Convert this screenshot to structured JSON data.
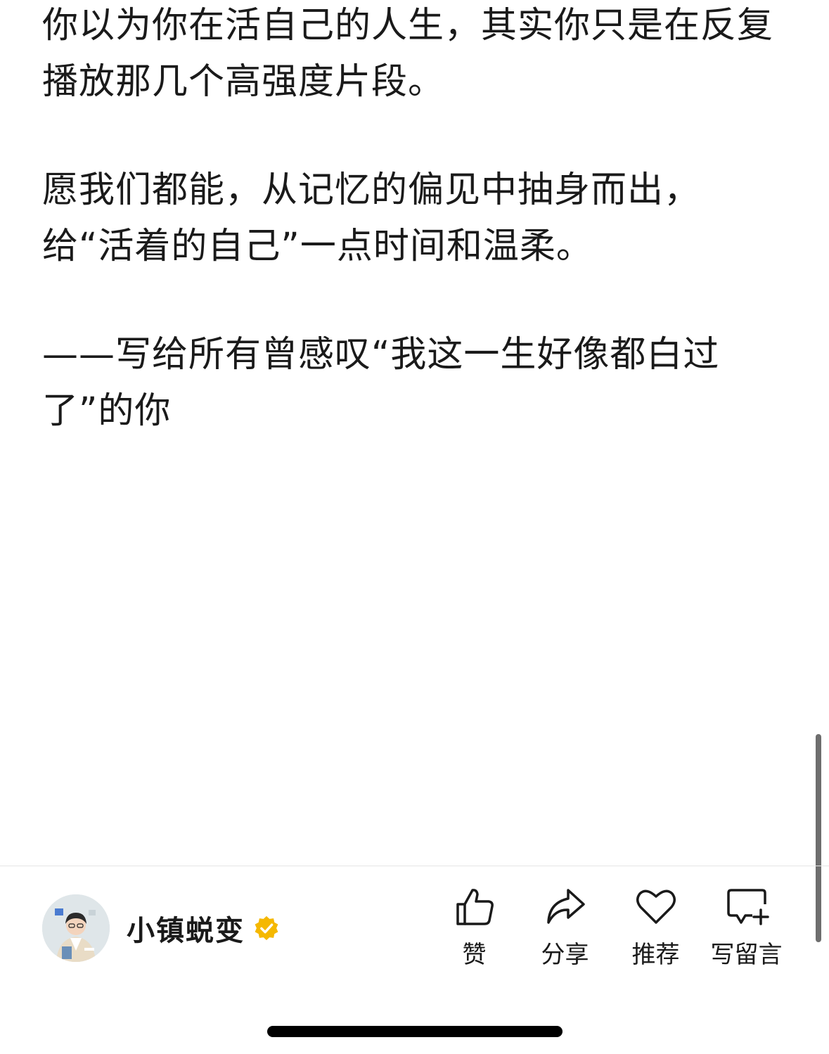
{
  "article": {
    "paragraphs": [
      "你以为你在活自己的人生，其实你只是在反复播放那几个高强度片段。",
      "愿我们都能，从记忆的偏见中抽身而出，给“活着的自己”一点时间和温柔。",
      "——写给所有曾感叹“我这一生好像都白过了”的你"
    ]
  },
  "author": {
    "name": "小镇蜕变",
    "verified_color": "#F5B800"
  },
  "actions": [
    {
      "icon": "thumbs-up-icon",
      "label": "赞"
    },
    {
      "icon": "share-arrow-icon",
      "label": "分享"
    },
    {
      "icon": "heart-icon",
      "label": "推荐"
    },
    {
      "icon": "comment-add-icon",
      "label": "写留言"
    }
  ]
}
